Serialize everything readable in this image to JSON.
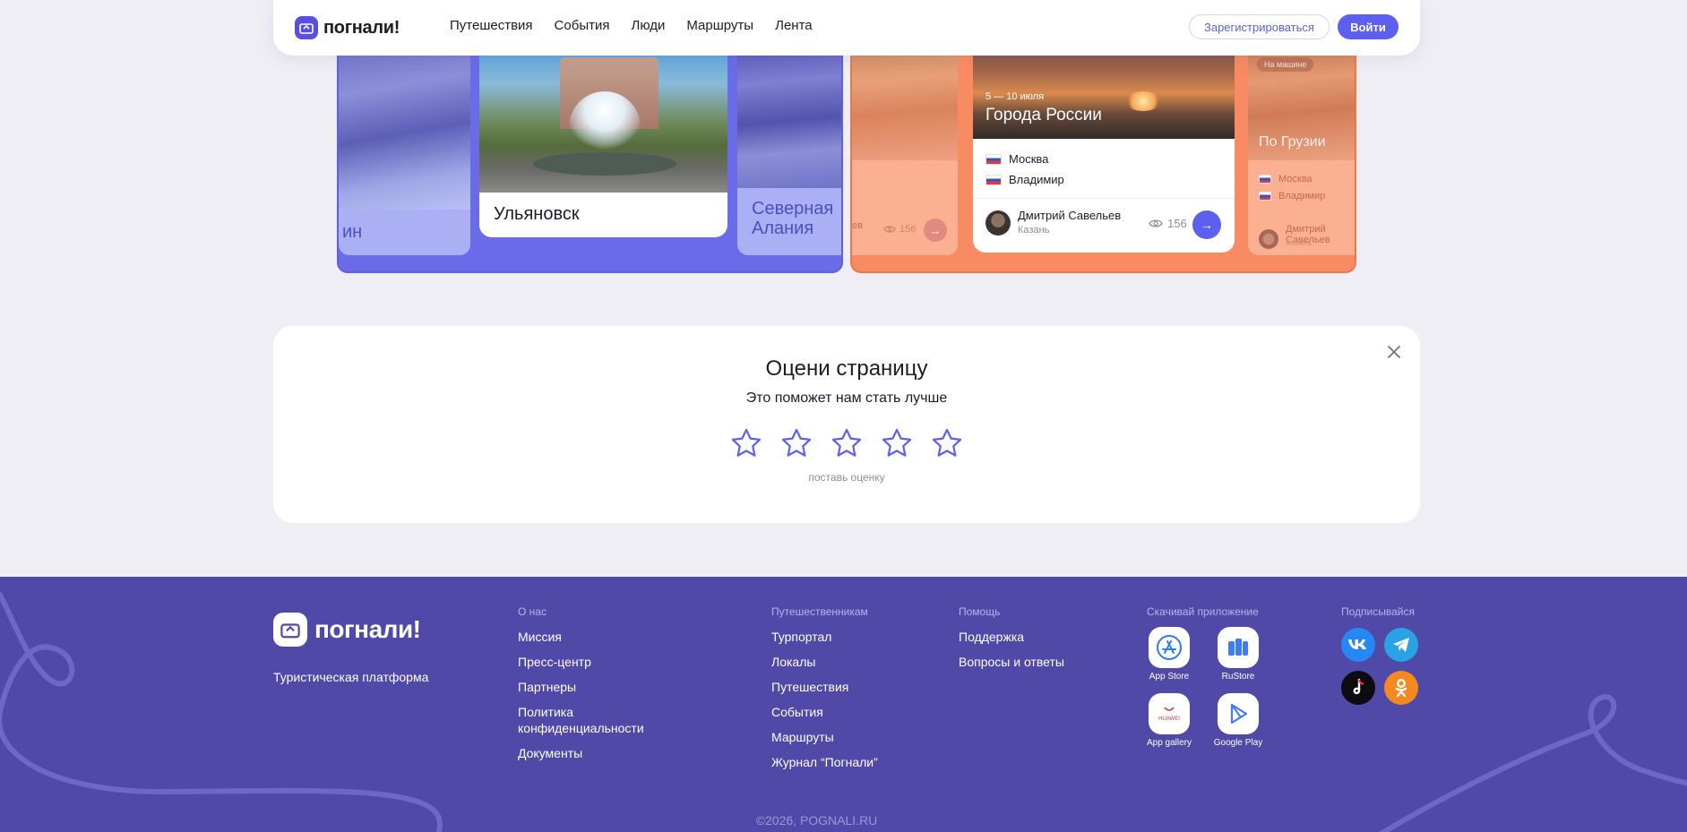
{
  "header": {
    "logo_text": "погнали!",
    "nav": [
      "Путешествия",
      "События",
      "Люди",
      "Маршруты",
      "Лента"
    ],
    "register_label": "Зарегистрироваться",
    "login_label": "Войти"
  },
  "blue_carousel": {
    "left_card_title": "ин",
    "main_card_title": "Ульяновск",
    "right_card_title": "Северная Алания"
  },
  "orange_carousel": {
    "left_card": {
      "author_fragment": "ев",
      "views": "156"
    },
    "main_card": {
      "date": "5 — 10 июля",
      "title": "Города России",
      "cities": [
        "Москва",
        "Владимир"
      ],
      "author_name": "Дмитрий Савельев",
      "author_city": "Казань",
      "views": "156"
    },
    "right_card": {
      "tag": "На машине",
      "title": "По Грузии",
      "cities": [
        "Москва",
        "Владимир"
      ],
      "author_name": "Дмитрий Савельев",
      "author_city": "Казань"
    }
  },
  "rating": {
    "title": "Оцени страницу",
    "subtitle": "Это поможет нам стать лучше",
    "stars_count": 5,
    "hint": "поставь оценку"
  },
  "footer": {
    "logo_text": "погнали!",
    "tagline": "Туристическая платформа",
    "columns": [
      {
        "heading": "О нас",
        "links": [
          "Миссия",
          "Пресс-центр",
          "Партнеры",
          "Политика конфиденциальности",
          "Документы"
        ]
      },
      {
        "heading": "Путешественникам",
        "links": [
          "Турпортал",
          "Локалы",
          "Путешествия",
          "События",
          "Маршруты",
          "Журнал “Погнали”"
        ]
      },
      {
        "heading": "Помощь",
        "links": [
          "Поддержка",
          "Вопросы и ответы"
        ]
      }
    ],
    "apps_heading": "Скачивай приложение",
    "apps": [
      "App Store",
      "RuStore",
      "App gallery",
      "Google Play"
    ],
    "app_gallery_brand": "HUAWEI",
    "social_heading": "Подписывайся",
    "social": [
      "vk-icon",
      "telegram-icon",
      "tiktok-icon",
      "odnoklassniki-icon"
    ],
    "copyright": "©2026, POGNALI.RU"
  },
  "colors": {
    "accent": "#5d5fef",
    "footer_bg": "#5049a8",
    "blue_panel": "#6a6be8",
    "orange_panel": "#f98b63",
    "page_bg": "#efeef5"
  }
}
